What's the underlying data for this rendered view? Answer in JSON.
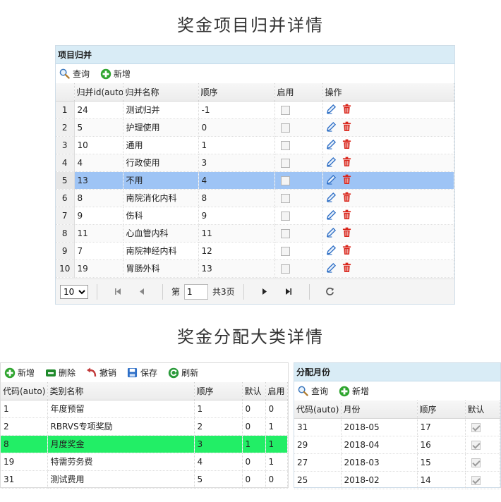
{
  "section1": {
    "title": "奖金项目归并详情"
  },
  "merge_panel": {
    "header": "项目归并",
    "toolbar": {
      "query": "查询",
      "add": "新增"
    },
    "columns": [
      "归并id(auto)",
      "归并名称",
      "顺序",
      "启用",
      "操作"
    ],
    "rows": [
      {
        "rn": "1",
        "id": "24",
        "name": "测试归并",
        "order": "-1"
      },
      {
        "rn": "2",
        "id": "5",
        "name": "护理使用",
        "order": "0"
      },
      {
        "rn": "3",
        "id": "10",
        "name": "通用",
        "order": "1"
      },
      {
        "rn": "4",
        "id": "4",
        "name": "行政使用",
        "order": "3"
      },
      {
        "rn": "5",
        "id": "13",
        "name": "不用",
        "order": "4"
      },
      {
        "rn": "6",
        "id": "8",
        "name": "南院消化内科",
        "order": "8"
      },
      {
        "rn": "7",
        "id": "9",
        "name": "伤科",
        "order": "9"
      },
      {
        "rn": "8",
        "id": "11",
        "name": "心血管内科",
        "order": "11"
      },
      {
        "rn": "9",
        "id": "7",
        "name": "南院神经内科",
        "order": "12"
      },
      {
        "rn": "10",
        "id": "19",
        "name": "胃肠外科",
        "order": "13"
      }
    ],
    "pager": {
      "page_size": "10",
      "page_label": "第",
      "current_page": "1",
      "total_label": "共3页"
    }
  },
  "section2": {
    "title": "奖金分配大类详情"
  },
  "category_panel": {
    "toolbar": {
      "add": "新增",
      "delete": "删除",
      "undo": "撤销",
      "save": "保存",
      "refresh": "刷新"
    },
    "columns": [
      "代码(auto)",
      "类别名称",
      "顺序",
      "默认",
      "启用"
    ],
    "rows": [
      {
        "code": "1",
        "name": "年度预留",
        "order": "1",
        "default": "0",
        "enabled": "0"
      },
      {
        "code": "2",
        "name": "RBRVS专项奖励",
        "order": "2",
        "default": "0",
        "enabled": "1"
      },
      {
        "code": "8",
        "name": "月度奖金",
        "order": "3",
        "default": "1",
        "enabled": "1"
      },
      {
        "code": "19",
        "name": "特需劳务费",
        "order": "4",
        "default": "0",
        "enabled": "1"
      },
      {
        "code": "31",
        "name": "测试费用",
        "order": "5",
        "default": "0",
        "enabled": "0"
      }
    ]
  },
  "month_panel": {
    "header": "分配月份",
    "toolbar": {
      "query": "查询",
      "add": "新增"
    },
    "columns": [
      "代码(auto)",
      "月份",
      "顺序",
      "默认"
    ],
    "rows": [
      {
        "code": "31",
        "month": "2018-05",
        "order": "17"
      },
      {
        "code": "29",
        "month": "2018-04",
        "order": "16"
      },
      {
        "code": "27",
        "month": "2018-03",
        "order": "15"
      },
      {
        "code": "25",
        "month": "2018-02",
        "order": "14"
      }
    ]
  },
  "colors": {
    "header_bg": "#d9ecf6",
    "selected_row": "#9ec4f5",
    "highlight_row": "#22ee66",
    "add_green": "#2fa52f",
    "delete_red": "#d9261c",
    "edit_blue": "#2b6cc4"
  },
  "icons": [
    "search-icon",
    "add-icon",
    "edit-icon",
    "trash-icon",
    "first-page-icon",
    "prev-page-icon",
    "next-page-icon",
    "last-page-icon",
    "refresh-icon",
    "delete-icon",
    "undo-icon",
    "save-icon"
  ]
}
